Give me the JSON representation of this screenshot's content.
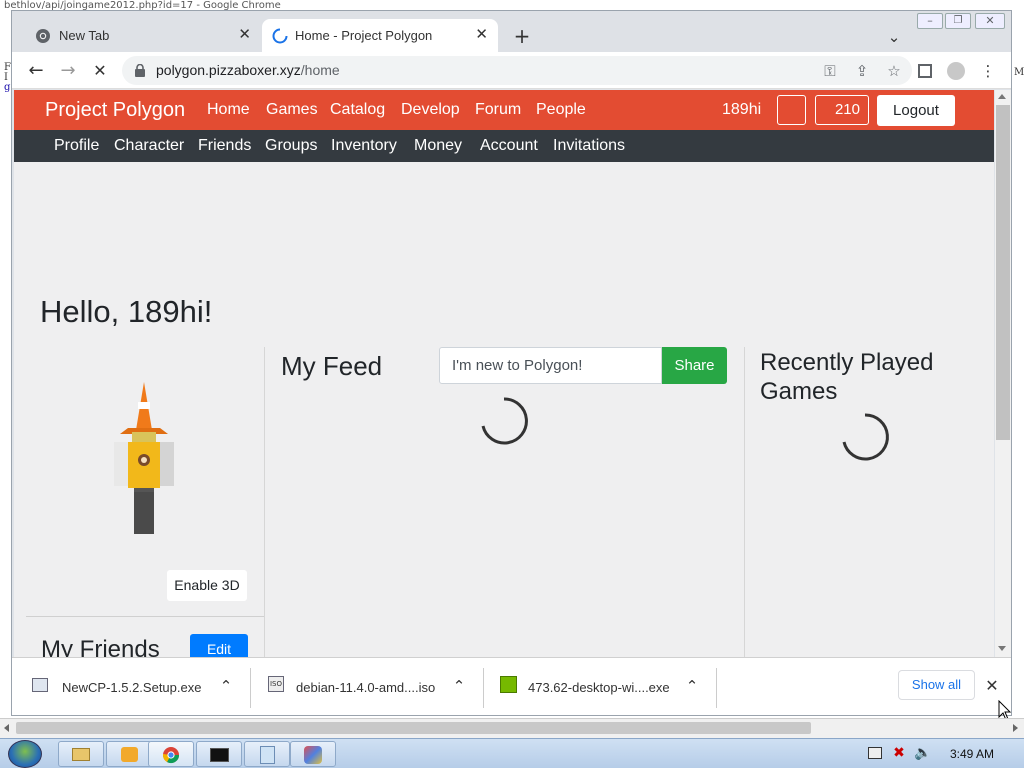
{
  "background_window": {
    "title": "bethlov/api/joingame2012.php?id=17 - Google Chrome",
    "text_lines": [
      "F",
      "I",
      "g"
    ],
    "right_char": "M"
  },
  "tabs": [
    {
      "label": "New Tab",
      "icon": "chrome-logo-icon",
      "active": false
    },
    {
      "label": "Home - Project Polygon",
      "icon": "loading-spinner-icon",
      "active": true
    }
  ],
  "new_tab_glyph": "+",
  "address_bar": {
    "host": "polygon.pizzaboxer.xyz",
    "path": "/home"
  },
  "site": {
    "brand": "Project Polygon",
    "nav": [
      "Home",
      "Games",
      "Catalog",
      "Develop",
      "Forum",
      "People"
    ],
    "username": "189hi",
    "currency": "210",
    "logout_label": "Logout",
    "subnav": [
      "Profile",
      "Character",
      "Friends",
      "Groups",
      "Inventory",
      "Money",
      "Account",
      "Invitations"
    ],
    "colors": {
      "primary": "#e34c32",
      "subnav": "#343a40",
      "share": "#28a745",
      "edit": "#007bff"
    }
  },
  "home": {
    "greeting": "Hello, 189hi!",
    "enable_3d_label": "Enable 3D",
    "my_friends_title": "My Friends",
    "edit_label": "Edit",
    "my_feed_title": "My Feed",
    "feed_placeholder": "I'm new to Polygon!",
    "share_label": "Share",
    "recent_games_title": "Recently Played Games"
  },
  "downloads": [
    {
      "name": "NewCP-1.5.2.Setup.exe",
      "icon": "installer-icon"
    },
    {
      "name": "debian-11.4.0-amd....iso",
      "icon": "iso-file-icon"
    },
    {
      "name": "473.62-desktop-wi....exe",
      "icon": "nvidia-icon"
    }
  ],
  "show_all_label": "Show all",
  "taskbar": {
    "clock": "3:49 AM"
  }
}
